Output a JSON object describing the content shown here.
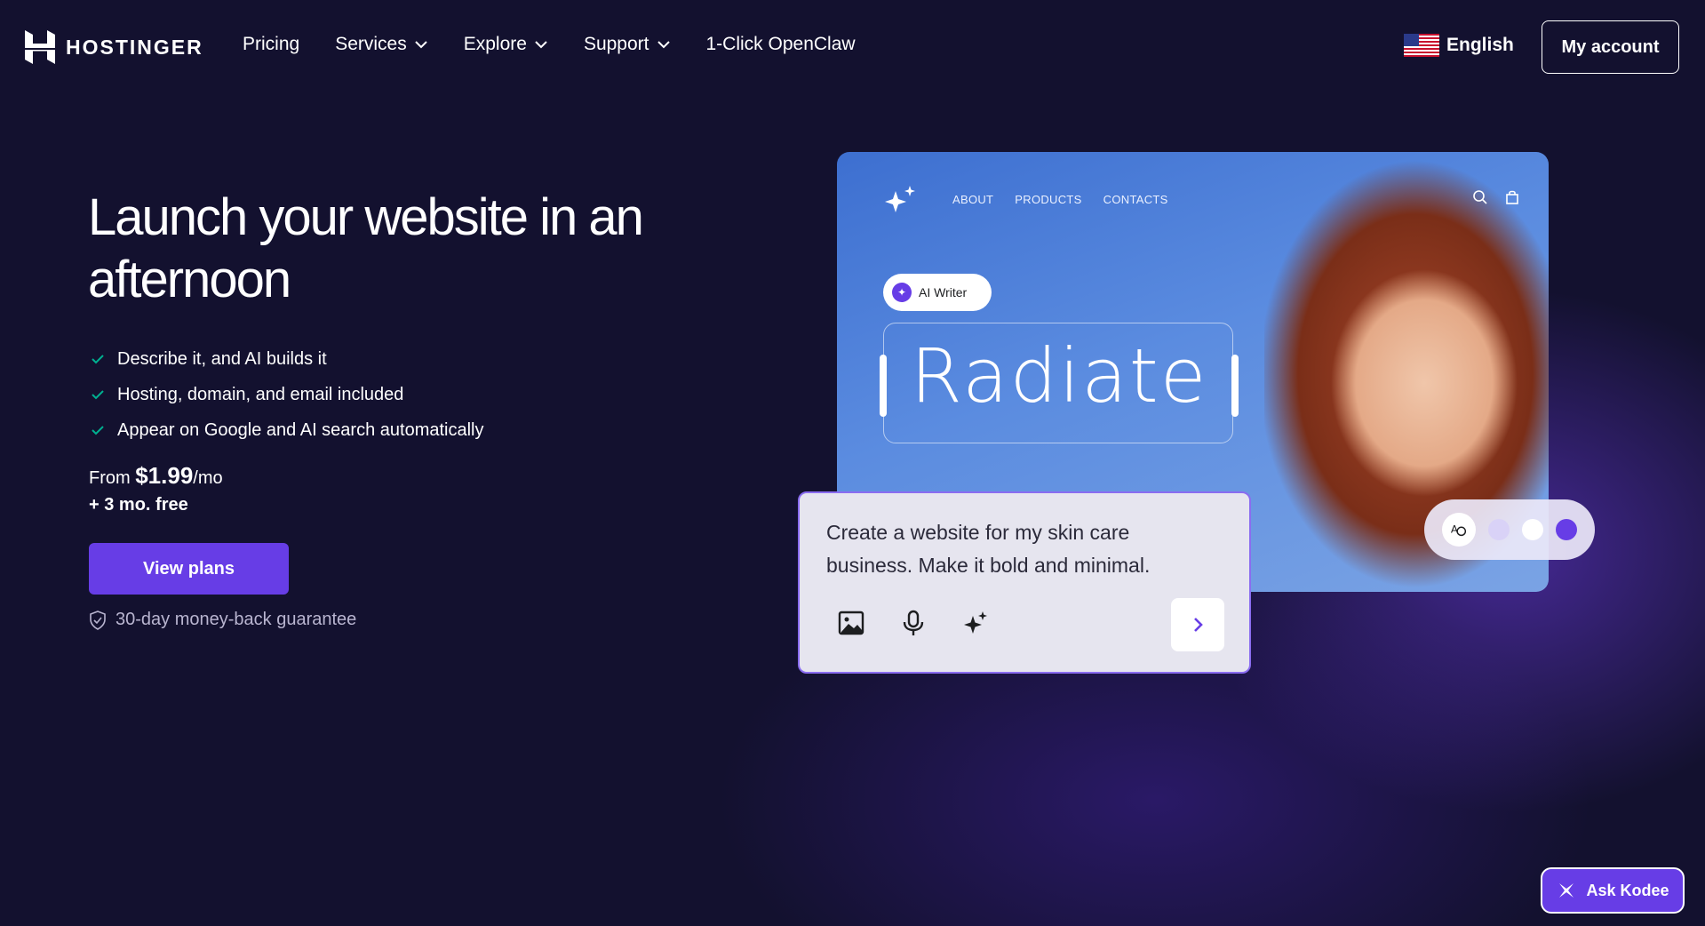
{
  "header": {
    "logo_text": "HOSTINGER",
    "nav": [
      {
        "label": "Pricing",
        "dropdown": false
      },
      {
        "label": "Services",
        "dropdown": true
      },
      {
        "label": "Explore",
        "dropdown": true
      },
      {
        "label": "Support",
        "dropdown": true
      },
      {
        "label": "1-Click OpenClaw",
        "dropdown": false
      }
    ],
    "language": "English",
    "account_button": "My account"
  },
  "hero": {
    "title": "Launch your website in an afternoon",
    "features": [
      "Describe it, and AI builds it",
      "Hosting, domain, and email included",
      "Appear on Google and AI search automatically"
    ],
    "price_prefix": "From ",
    "price_amount": "$1.99",
    "price_suffix": "/mo",
    "price_bonus": "+ 3 mo. free",
    "cta": "View plans",
    "guarantee": "30-day money-back guarantee"
  },
  "mockup": {
    "nav": [
      "ABOUT",
      "PRODUCTS",
      "CONTACTS"
    ],
    "ai_writer_label": "AI Writer",
    "headline": "Radiate",
    "prompt": "Create a website for my skin care business. Make it bold and minimal.",
    "palette_colors": [
      "#d9d2f7",
      "#ffffff",
      "#673de6"
    ]
  },
  "chat": {
    "label": "Ask Kodee"
  },
  "colors": {
    "background": "#13112f",
    "brand_purple": "#673de6",
    "check_green": "#00b090"
  }
}
